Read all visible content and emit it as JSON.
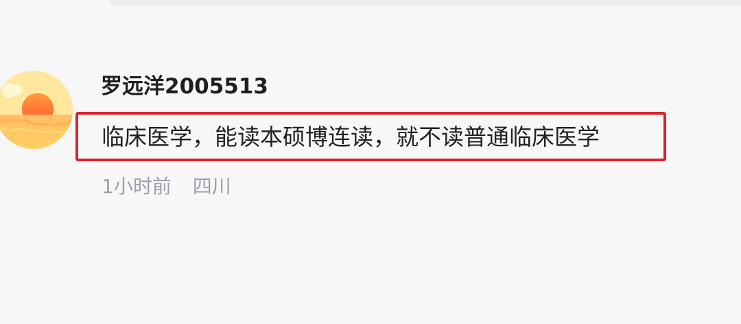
{
  "comment": {
    "username": "罗远洋2005513",
    "text": "临床医学，能读本硕博连读，就不读普通临床医学",
    "time": "1小时前",
    "location": "四川",
    "avatar_icon": "sunset-avatar-icon",
    "highlight_color": "#d8232f"
  }
}
